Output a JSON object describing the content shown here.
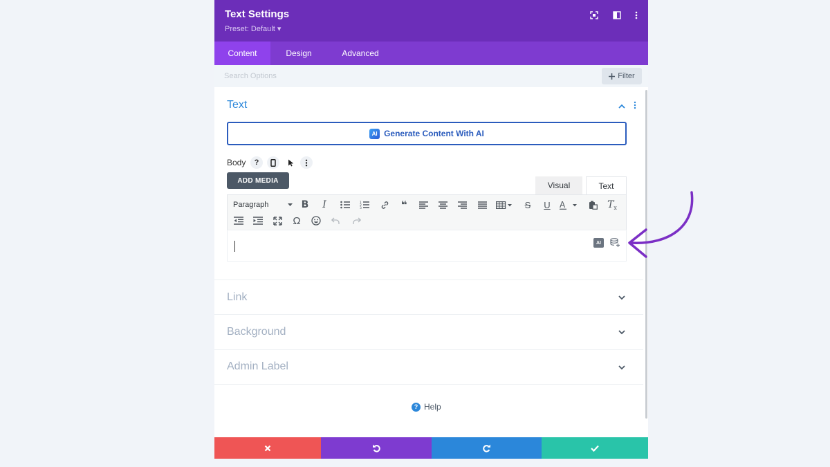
{
  "header": {
    "title": "Text Settings",
    "preset": "Preset: Default ▾",
    "icons": [
      "focus-icon",
      "split-view-icon",
      "more-vertical-icon"
    ]
  },
  "tabs": [
    {
      "label": "Content",
      "active": true
    },
    {
      "label": "Design",
      "active": false
    },
    {
      "label": "Advanced",
      "active": false
    }
  ],
  "search": {
    "placeholder": "Search Options",
    "value": ""
  },
  "filter": {
    "label": "Filter"
  },
  "text_section": {
    "title": "Text",
    "ai_button": "Generate Content With AI",
    "ai_badge": "AI",
    "body_label": "Body",
    "add_media": "ADD MEDIA",
    "editor_tabs": {
      "visual": "Visual",
      "text": "Text"
    },
    "paragraph_format": "Paragraph",
    "toolbar_row1": [
      "bold-icon",
      "italic-icon",
      "bullet-list-icon",
      "numbered-list-icon",
      "link-icon",
      "blockquote-icon",
      "align-left-icon",
      "align-center-icon",
      "align-right-icon",
      "align-justify-icon",
      "table-icon",
      "strikethrough-icon",
      "underline-icon",
      "text-color-icon",
      "paste-icon",
      "clear-format-icon"
    ],
    "toolbar_row2": [
      "outdent-icon",
      "indent-icon",
      "fullscreen-icon",
      "omega-icon",
      "emoji-icon",
      "undo-icon",
      "redo-icon"
    ],
    "editor_ai_badge": "AI"
  },
  "collapsed_sections": [
    {
      "title": "Link"
    },
    {
      "title": "Background"
    },
    {
      "title": "Admin Label"
    }
  ],
  "help": {
    "label": "Help"
  },
  "footer": {
    "buttons": [
      {
        "name": "discard",
        "color": "#ef5555"
      },
      {
        "name": "undo",
        "color": "#7e3bd0"
      },
      {
        "name": "redo",
        "color": "#2b87da"
      },
      {
        "name": "save",
        "color": "#29c4a9"
      }
    ]
  },
  "colors": {
    "header": "#6c2eb9",
    "tabs": "#7e3bd0",
    "active_tab": "#8f42ec",
    "accent_blue": "#2b87da",
    "annotation_arrow": "#7b2fc5"
  }
}
